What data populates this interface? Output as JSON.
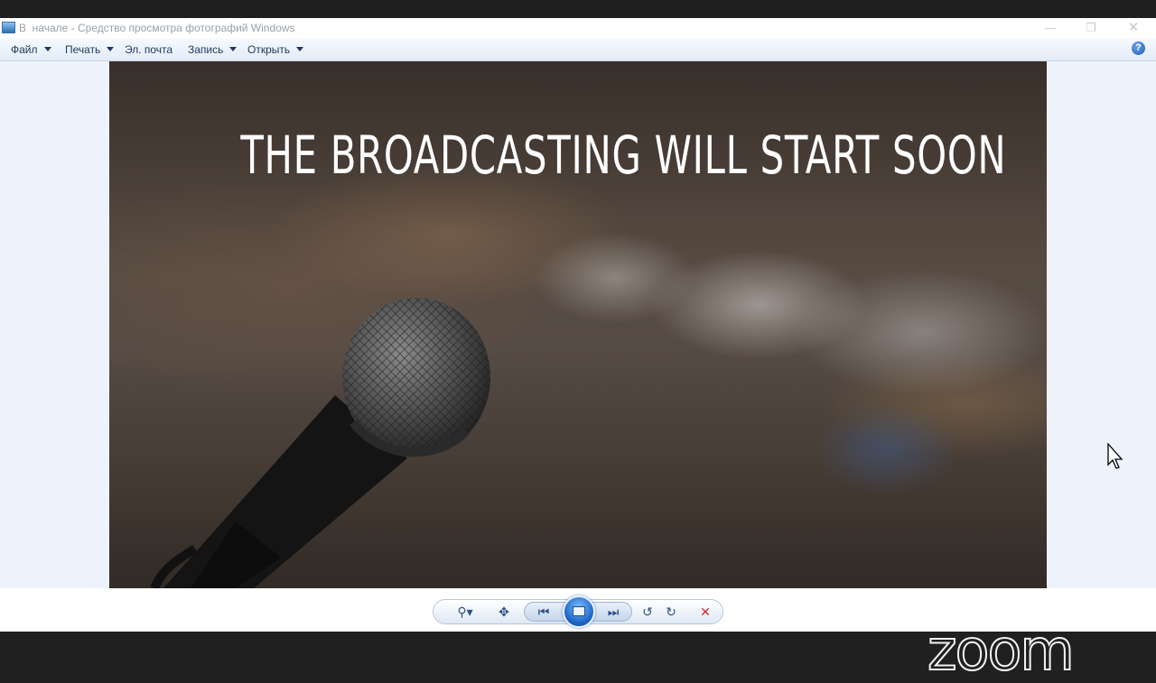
{
  "window": {
    "title": "В  начале - Средство просмотра фотографий Windows",
    "minimize_glyph": "—",
    "maximize_glyph": "❐",
    "close_glyph": "✕"
  },
  "menu": {
    "items": [
      {
        "label": "Файл",
        "has_dropdown": true
      },
      {
        "label": "Печать",
        "has_dropdown": true
      },
      {
        "label": "Эл. почта",
        "has_dropdown": false
      },
      {
        "label": "Запись",
        "has_dropdown": true
      },
      {
        "label": "Открыть",
        "has_dropdown": true
      }
    ],
    "help_glyph": "?"
  },
  "photo": {
    "headline": "THE BROADCASTING WILL START SOON",
    "description_icons": [
      "microphone",
      "blurred-audience"
    ]
  },
  "overlay": {
    "logo": "zoom"
  },
  "controls": {
    "zoom_icon": "magnifier-icon",
    "fit_icon": "actual-size-icon",
    "prev_icon": "previous-icon",
    "slideshow_icon": "slideshow-icon",
    "next_icon": "next-icon",
    "rotate_ccw_icon": "rotate-counterclockwise-icon",
    "rotate_cw_icon": "rotate-clockwise-icon",
    "delete_icon": "delete-icon"
  },
  "colors": {
    "menu_text": "#1e395b",
    "delete_red": "#d42a2a",
    "control_blue": "#2c4f86"
  }
}
